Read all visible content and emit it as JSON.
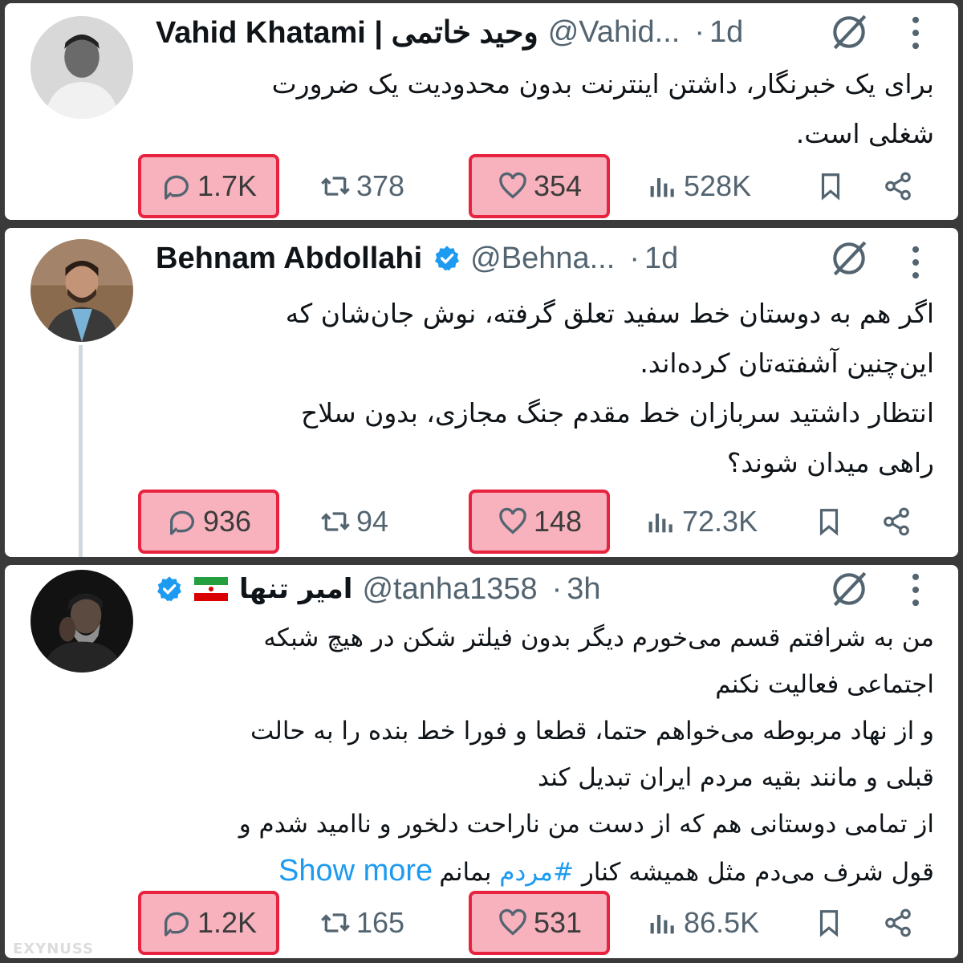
{
  "tweets": [
    {
      "name": "Vahid Khatami | وحید خاتمی",
      "handle": "@Vahid...",
      "dot": "·",
      "time": "1d",
      "lines": [
        "برای یک خبرنگار، داشتن اینترنت بدون محدودیت یک ضرورت",
        "شغلی است."
      ],
      "replies": "1.7K",
      "reposts": "378",
      "likes": "354",
      "views": "528K"
    },
    {
      "name": "Behnam Abdollahi",
      "handle": "@Behna...",
      "dot": "·",
      "time": "1d",
      "lines": [
        "اگر هم به دوستان خط سفید تعلق گرفته، نوش جان‌شان که",
        "این‌چنین آشفته‌تان کرده‌اند.",
        "انتظار داشتید سربازان خط مقدم جنگ مجازی، بدون سلاح",
        "راهی میدان شوند؟"
      ],
      "replies": "936",
      "reposts": "94",
      "likes": "148",
      "views": "72.3K"
    },
    {
      "name": "امیر تنها",
      "handle": "@tanha1358",
      "dot": "·",
      "time": "3h",
      "lines": [
        "من به شرافتم قسم می‌خورم دیگر بدون فیلتر شکن در هیچ شبکه",
        "اجتماعی فعالیت نکنم",
        "و از نهاد مربوطه می‌خواهم حتما، قطعا و فورا خط بنده را به حالت",
        "قبلی و مانند بقیه مردم ایران تبدیل کند",
        "از تمامی دوستانی هم که از دست من ناراحت دلخور و ناامید شدم و"
      ],
      "last_line_start": "قول شرف می‌دم مثل همیشه کنار ",
      "hashtag": "#مردم",
      "last_line_end": " بمانم",
      "show_more": "Show more",
      "replies": "1.2K",
      "reposts": "165",
      "likes": "531",
      "views": "86.5K"
    }
  ],
  "watermark": "EXYNUSS",
  "colors": {
    "highlight_fill": "#f7b2bd",
    "highlight_border": "#e8233f",
    "link": "#1d9bf0",
    "verified": "#1d9bf0",
    "muted": "#536471"
  }
}
